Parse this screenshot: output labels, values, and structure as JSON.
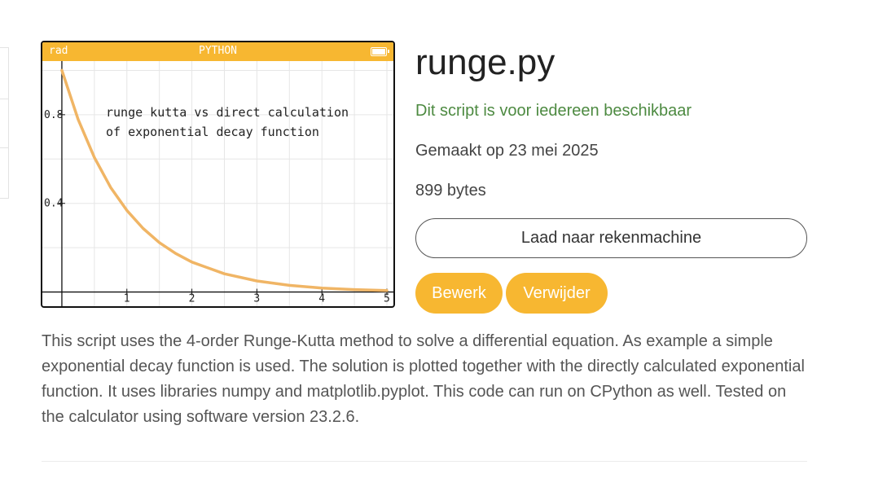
{
  "calculator": {
    "angle_mode": "rad",
    "language": "PYTHON",
    "battery_icon": "battery-full-icon",
    "status_bar_color": "#f7b731"
  },
  "chart_data": {
    "type": "line",
    "title": "runge kutta vs direct calculation\nof exponential decay function",
    "title_lines": [
      "runge kutta vs direct calculation",
      "of exponential decay function"
    ],
    "xlabel": "",
    "ylabel": "",
    "xlim": [
      -0.25,
      5.05
    ],
    "ylim": [
      -0.02,
      1.02
    ],
    "x_ticks": [
      "1",
      "2",
      "3",
      "4",
      "5"
    ],
    "y_ticks": [
      "0.4",
      "0.8"
    ],
    "grid": true,
    "series": [
      {
        "color": "#f0b565",
        "x": [
          0,
          0.25,
          0.5,
          0.75,
          1,
          1.25,
          1.5,
          1.75,
          2,
          2.5,
          3,
          3.5,
          4,
          4.5,
          5
        ],
        "y": [
          1.0,
          0.779,
          0.607,
          0.472,
          0.368,
          0.287,
          0.223,
          0.174,
          0.135,
          0.082,
          0.05,
          0.03,
          0.018,
          0.011,
          0.007
        ]
      },
      {
        "color": "#a8c0dc",
        "x": [
          0,
          0.25,
          0.5,
          0.75,
          1,
          1.25,
          1.5,
          1.75,
          2,
          2.5,
          3,
          3.5,
          4,
          4.5,
          5
        ],
        "y": [
          1.0,
          0.779,
          0.607,
          0.472,
          0.368,
          0.287,
          0.223,
          0.174,
          0.135,
          0.082,
          0.05,
          0.03,
          0.018,
          0.011,
          0.007
        ]
      }
    ]
  },
  "script": {
    "title": "runge.py",
    "availability": "Dit script is voor iedereen beschikbaar",
    "created": "Gemaakt op 23 mei 2025",
    "size": "899 bytes"
  },
  "actions": {
    "load_label": "Laad naar rekenmachine",
    "edit_label": "Bewerk",
    "delete_label": "Verwijder"
  },
  "description": "This script uses the 4-order Runge-Kutta method to solve a differential equation. As example a simple exponential decay function is used. The solution is plotted together with the directly calculated exponential function. It uses libraries numpy and matplotlib.pyplot. This code can run on CPython as well. Tested on the calculator using software version 23.2.6.",
  "colors": {
    "accent": "#f7b731",
    "availability_green": "#4d8a41"
  }
}
